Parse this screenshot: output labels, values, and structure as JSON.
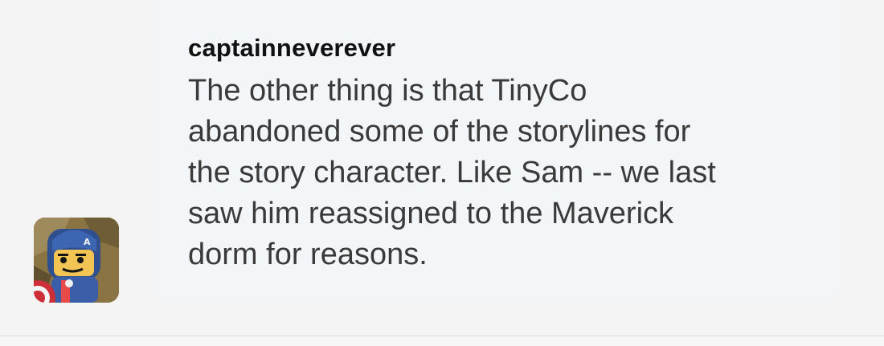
{
  "chat": {
    "username": "captainneverever",
    "message": "The other thing is that TinyCo\nabandoned some of the storylines for\nthe story character. Like Sam -- we last\nsaw him reassigned to the Maverick\ndorm for reasons."
  },
  "avatar": {
    "icon": "lego-captain-america-avatar"
  },
  "colors": {
    "page_background": "#f2f2f2",
    "bubble_background": "#f2f6f9",
    "username_color": "#111111",
    "message_color": "#3a3a3a"
  }
}
